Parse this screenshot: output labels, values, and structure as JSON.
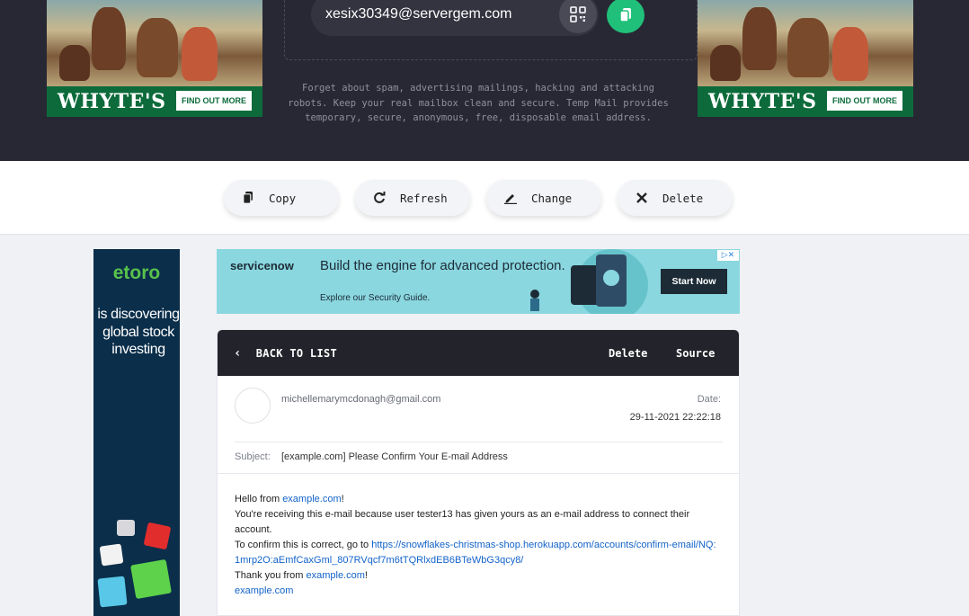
{
  "header": {
    "email_address": "xesix30349@servergem.com",
    "tagline": "Forget about spam, advertising mailings, hacking and attacking robots. Keep your real mailbox clean and secure. Temp Mail provides temporary, secure, anonymous, free, disposable email address."
  },
  "ads": {
    "whytes_brand": "WHYTE'S",
    "whytes_cta": "FIND OUT MORE",
    "etoro_logo": "etoro",
    "etoro_text": "is discovering global stock investing",
    "servicenow_logo": "servicenow",
    "servicenow_headline": "Build the engine for advanced protection.",
    "servicenow_sub": "Explore our Security Guide.",
    "servicenow_cta": "Start Now"
  },
  "actions": {
    "copy": "Copy",
    "refresh": "Refresh",
    "change": "Change",
    "delete": "Delete"
  },
  "message": {
    "back_label": "BACK TO LIST",
    "delete_label": "Delete",
    "source_label": "Source",
    "sender": "michellemarymcdonagh@gmail.com",
    "date_label": "Date:",
    "date_value": "29-11-2021 22:22:18",
    "subject_label": "Subject:",
    "subject_value": "[example.com] Please Confirm Your E-mail Address",
    "body": {
      "hello_prefix": "Hello from ",
      "site_link": "example.com",
      "hello_suffix": "!",
      "line2": "You're receiving this e-mail because user tester13 has given yours as an e-mail address to connect their account.",
      "confirm_prefix": "To confirm this is correct, go to ",
      "confirm_link": "https://snowflakes-christmas-shop.herokuapp.com/accounts/confirm-email/NQ:1mrp2O:aEmfCaxGml_807RVqcf7m6tTQRlxdEB6BTeWbG3qcy8/",
      "thanks_prefix": "Thank you from ",
      "thanks_link": "example.com",
      "thanks_suffix": "!",
      "signature_link": "example.com"
    }
  },
  "colors": {
    "topband": "#272834",
    "accent_green": "#21c07a",
    "link_blue": "#1363c9",
    "card_header": "#22232b"
  }
}
